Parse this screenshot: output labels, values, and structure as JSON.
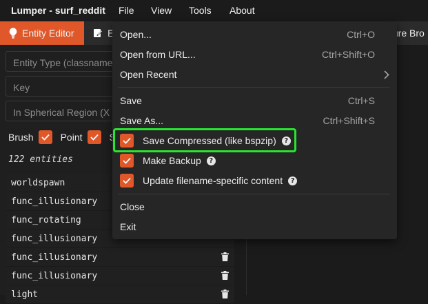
{
  "app": {
    "title": "Lumper - surf_reddit"
  },
  "menubar": {
    "items": [
      "File",
      "View",
      "Tools",
      "About"
    ]
  },
  "tabs": [
    {
      "label": "Entity Editor",
      "icon": "lightbulb-icon",
      "active": true
    },
    {
      "label": "E",
      "icon": "edit-icon",
      "active": false
    },
    {
      "label": "ture Bro",
      "active": false
    }
  ],
  "sidebar": {
    "entity_type_placeholder": "Entity Type (classname",
    "key_placeholder": "Key",
    "region_placeholder": "In Spherical Region (X Y",
    "filters": [
      {
        "label": "Brush",
        "checked": true
      },
      {
        "label": "Point",
        "checked": true
      },
      {
        "label": "S",
        "checked": false
      }
    ],
    "count_label": "122 entities",
    "entities": [
      {
        "name": "worldspawn",
        "deletable": false
      },
      {
        "name": "func_illusionary",
        "deletable": false
      },
      {
        "name": "func_rotating",
        "deletable": false
      },
      {
        "name": "func_illusionary",
        "deletable": false
      },
      {
        "name": "func_illusionary",
        "deletable": true
      },
      {
        "name": "func_illusionary",
        "deletable": true
      },
      {
        "name": "light",
        "deletable": true
      }
    ]
  },
  "file_menu": {
    "open": {
      "label": "Open...",
      "shortcut": "Ctrl+O"
    },
    "open_url": {
      "label": "Open from URL...",
      "shortcut": "Ctrl+Shift+O"
    },
    "open_recent": {
      "label": "Open Recent"
    },
    "save": {
      "label": "Save",
      "shortcut": "Ctrl+S"
    },
    "save_as": {
      "label": "Save As...",
      "shortcut": "Ctrl+Shift+S"
    },
    "save_compressed": {
      "label": "Save Compressed (like bspzip)",
      "checked": true
    },
    "make_backup": {
      "label": "Make Backup",
      "checked": true
    },
    "update_filename": {
      "label": "Update filename-specific content",
      "checked": true
    },
    "close": {
      "label": "Close"
    },
    "exit": {
      "label": "Exit"
    }
  },
  "colors": {
    "accent": "#e0582a",
    "highlight": "#27e62f",
    "menu_bg": "#262626"
  }
}
